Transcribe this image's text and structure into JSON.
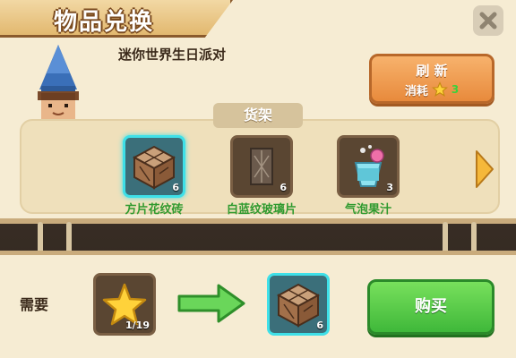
{
  "window": {
    "title": "物品兑换"
  },
  "npc": {
    "name": "迷你世界生日派对"
  },
  "refresh": {
    "label": "刷 新",
    "cost_label": "消耗",
    "cost_value": "3",
    "cost_icon": "star-icon"
  },
  "shelf": {
    "title": "货架",
    "items": [
      {
        "name": "方片花纹砖",
        "count": "6",
        "icon": "patterned-brick-icon",
        "selected": true
      },
      {
        "name": "白蓝纹玻璃片",
        "count": "6",
        "icon": "glass-pane-icon",
        "selected": false
      },
      {
        "name": "气泡果汁",
        "count": "3",
        "icon": "bubble-juice-icon",
        "selected": false
      }
    ]
  },
  "exchange": {
    "need_label": "需要",
    "cost_item_icon": "star-icon",
    "cost_count": "1/19",
    "result_item_icon": "patterned-brick-icon",
    "result_count": "6",
    "buy_label": "购买"
  },
  "colors": {
    "selected_border": "#3fe0e8",
    "item_name": "#2f9a2f",
    "buy_button": "#4fc63f",
    "refresh_button": "#ef9a4e"
  }
}
